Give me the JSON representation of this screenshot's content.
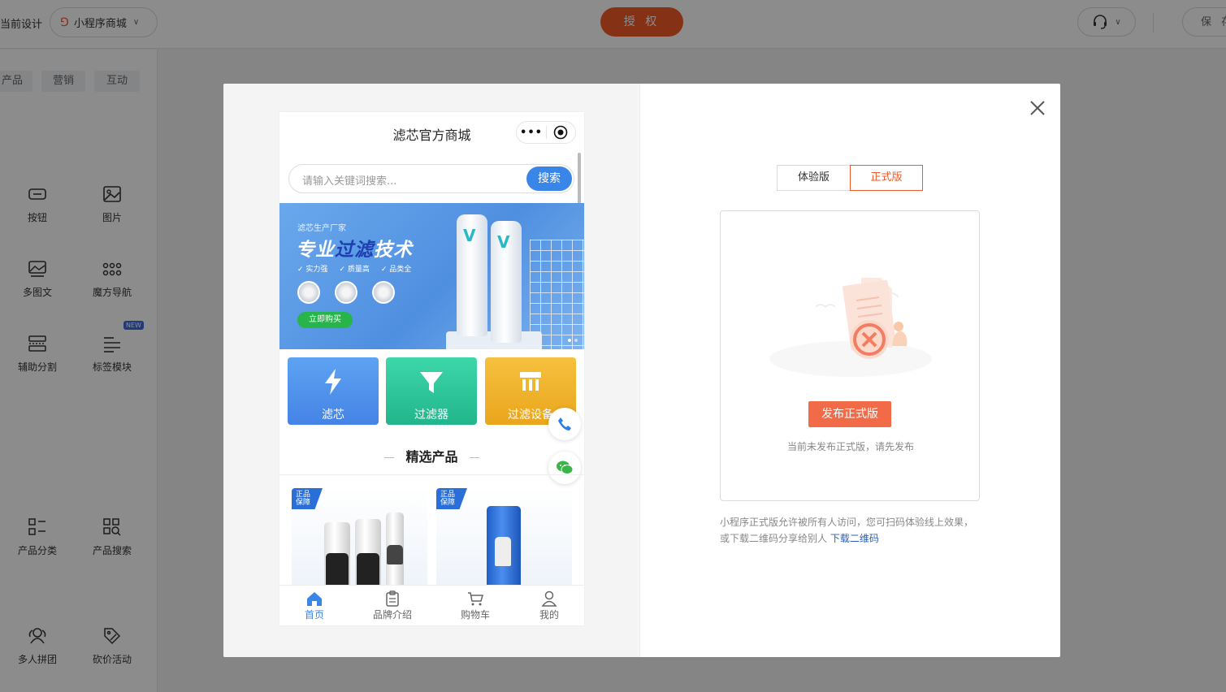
{
  "topbar": {
    "current_design_label": "当前设计",
    "app_name": "小程序商城",
    "authorize_label": "授 权",
    "save_label": "保 存"
  },
  "sidebar": {
    "tabs": [
      "产品",
      "营销",
      "互动"
    ],
    "components": [
      {
        "label": "按钮",
        "icon": "button-icon"
      },
      {
        "label": "图片",
        "icon": "image-icon"
      },
      {
        "label": "多图文",
        "icon": "multi-image-text-icon"
      },
      {
        "label": "魔方导航",
        "icon": "grid-nav-icon"
      },
      {
        "label": "辅助分割",
        "icon": "divider-icon"
      },
      {
        "label": "标签模块",
        "icon": "tag-module-icon",
        "badge": "NEW"
      },
      {
        "label": "产品分类",
        "icon": "product-category-icon"
      },
      {
        "label": "产品搜索",
        "icon": "product-search-icon"
      },
      {
        "label": "多人拼团",
        "icon": "group-buy-icon"
      },
      {
        "label": "砍价活动",
        "icon": "bargain-icon"
      }
    ]
  },
  "phone": {
    "title": "滤芯官方商城",
    "capsule_dots": "•••",
    "search_placeholder": "请输入关键词搜索...",
    "search_button": "搜索",
    "banner": {
      "factory": "滤芯生产厂家",
      "headline_a": "专业",
      "headline_b": "过滤",
      "headline_c": "技术",
      "features": [
        "实力强",
        "质量高",
        "品类全"
      ],
      "buy_button": "立即购买"
    },
    "categories": [
      {
        "label": "滤芯",
        "color": "#4f95ee"
      },
      {
        "label": "过滤器",
        "color": "#2fc99a"
      },
      {
        "label": "过滤设备",
        "color": "#f2b22a"
      }
    ],
    "section_title": "精选产品",
    "product_badge": [
      "正品",
      "保障"
    ],
    "tabbar": [
      "首页",
      "品牌介绍",
      "购物车",
      "我的"
    ]
  },
  "publish": {
    "tabs": [
      "体验版",
      "正式版"
    ],
    "active_tab": "正式版",
    "publish_button": "发布正式版",
    "empty_text": "当前未发布正式版，请先发布",
    "description": "小程序正式版允许被所有人访问，您可扫码体验线上效果，或下载二维码分享给别人",
    "download_link": "下载二维码"
  },
  "colors": {
    "accent": "#f05a28",
    "phone_primary": "#3a86e8"
  }
}
